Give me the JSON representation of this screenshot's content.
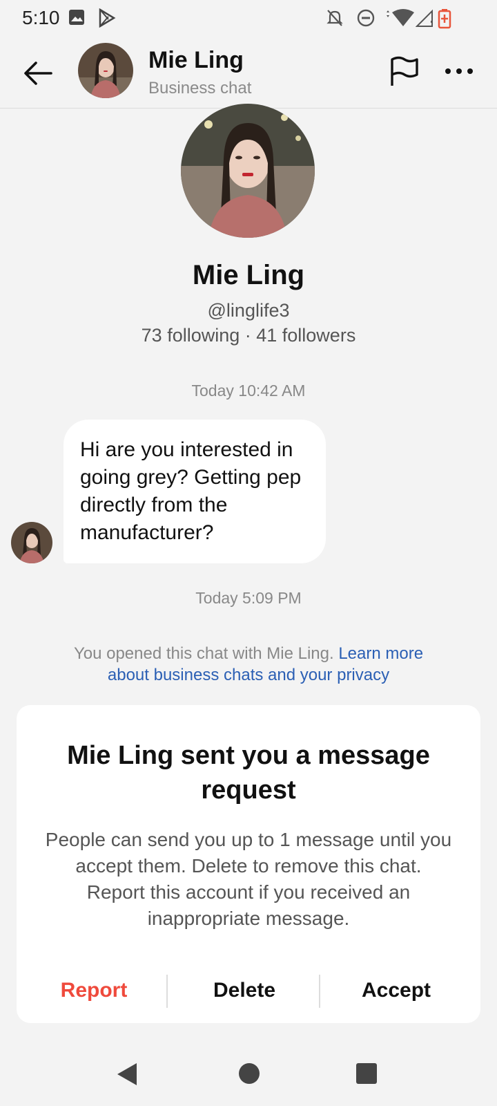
{
  "status_bar": {
    "time": "5:10"
  },
  "header": {
    "name": "Mie Ling",
    "subtitle": "Business chat"
  },
  "profile": {
    "name": "Mie Ling",
    "handle": "@linglife3",
    "stats": "73 following · 41 followers"
  },
  "chat": {
    "timestamp_1": "Today 10:42 AM",
    "message": "Hi are you interested in going grey? Getting pep directly from the manufacturer?",
    "timestamp_2": "Today 5:09 PM",
    "privacy_text": "You opened this chat with Mie Ling.",
    "privacy_link": "Learn more about business chats and your privacy"
  },
  "request_card": {
    "title": "Mie Ling sent you a message request",
    "body": "People can send you up to 1 message until you accept them. Delete to remove this chat. Report this account if you received an inappropriate message.",
    "report_label": "Report",
    "delete_label": "Delete",
    "accept_label": "Accept"
  },
  "colors": {
    "background": "#f3f3f3",
    "report": "#ef4a3c",
    "link": "#2b5fb4"
  },
  "icons": [
    "back-arrow-icon",
    "flag-icon",
    "more-icon",
    "nav-back-icon",
    "nav-home-icon",
    "nav-recents-icon"
  ]
}
